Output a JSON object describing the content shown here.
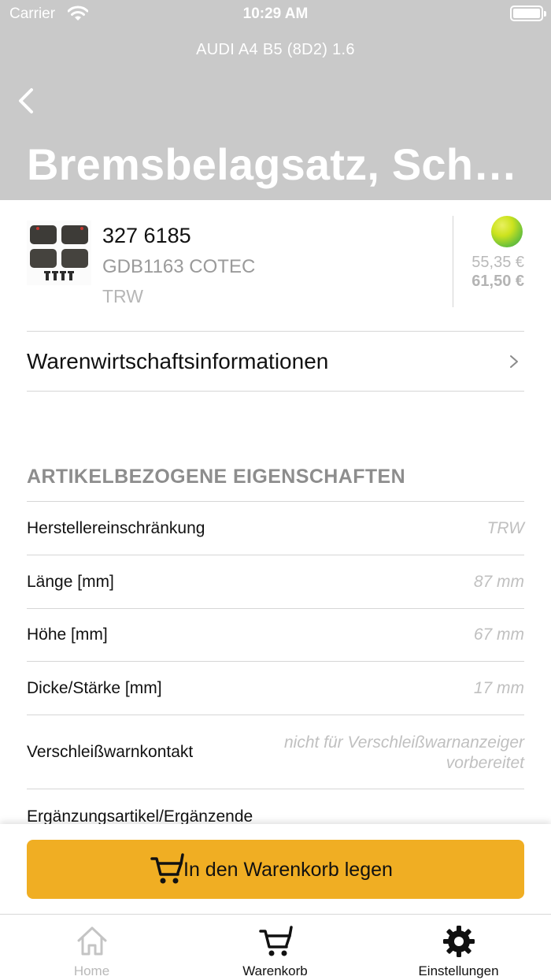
{
  "status_bar": {
    "carrier": "Carrier",
    "time": "10:29 AM"
  },
  "header": {
    "vehicle": "AUDI A4 B5 (8D2) 1.6",
    "title": "Bremsbelagsatz, Schei..."
  },
  "article": {
    "number": "327 6185",
    "code": "GDB1163 COTEC",
    "brand": "TRW",
    "price_net": "55,35 €",
    "price_gross": "61,50 €",
    "availability_color": "#8fd12c"
  },
  "inventory_link": {
    "label": "Warenwirtschaftsinformationen"
  },
  "properties": {
    "section_title": "ARTIKELBEZOGENE EIGENSCHAFTEN",
    "rows": [
      {
        "label": "Herstellereinschränkung",
        "value": "TRW"
      },
      {
        "label": "Länge [mm]",
        "value": "87 mm"
      },
      {
        "label": "Höhe [mm]",
        "value": "67 mm"
      },
      {
        "label": "Dicke/Stärke [mm]",
        "value": "17 mm"
      },
      {
        "label": "Verschleißwarnkontakt",
        "value": "nicht für Verschleißwarnanzeiger vorbereitet"
      },
      {
        "label": "Ergänzungsartikel/Ergänzende",
        "value": ""
      }
    ]
  },
  "cart_button": {
    "label": "In den Warenkorb legen",
    "color": "#f0ae23"
  },
  "tabs": [
    {
      "label": "Home",
      "icon": "home-icon",
      "active": false
    },
    {
      "label": "Warenkorb",
      "icon": "cart-icon",
      "active": true
    },
    {
      "label": "Einstellungen",
      "icon": "gear-icon",
      "active": true
    }
  ]
}
